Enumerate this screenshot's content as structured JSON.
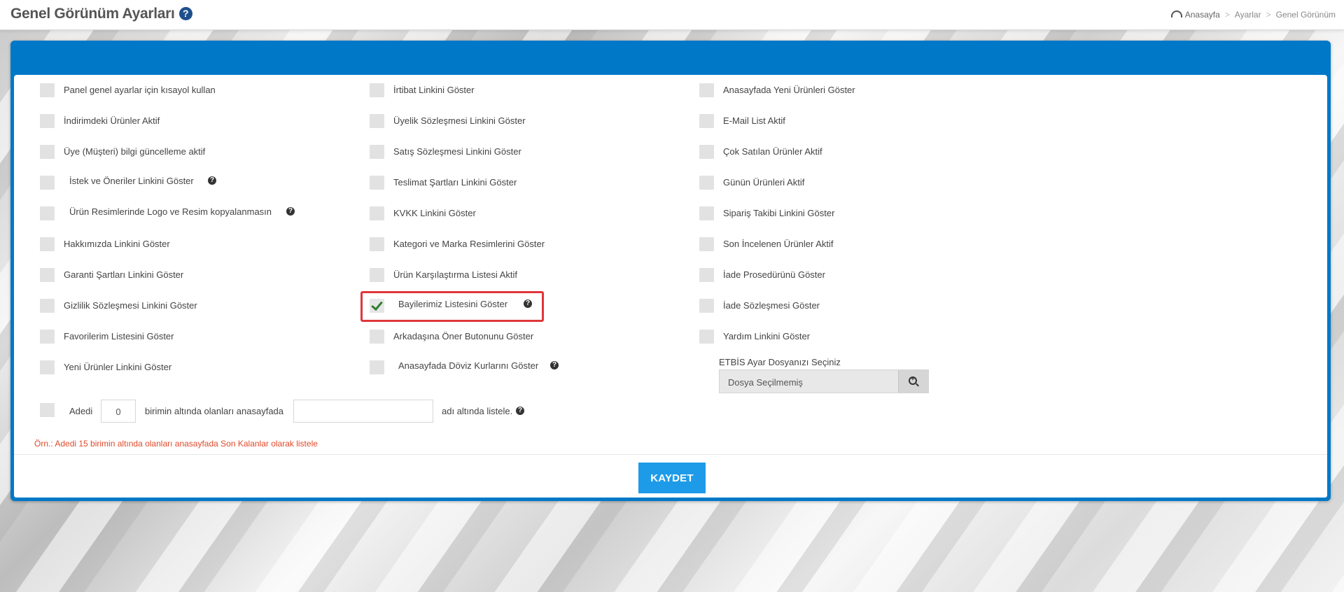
{
  "header": {
    "title": "Genel Görünüm Ayarları",
    "help_icon": "question-circle-icon",
    "breadcrumb": [
      "Anasayfa",
      "Ayarlar",
      "Genel Görünüm"
    ]
  },
  "column1": [
    {
      "label": "Panel genel ayarlar için kısayol kullan",
      "checked": false
    },
    {
      "label": "İndirimdeki Ürünler Aktif",
      "checked": false
    },
    {
      "label": "Üye (Müşteri) bilgi güncelleme aktif",
      "checked": false
    },
    {
      "label": "İstek ve Öneriler Linkini Göster",
      "checked": false,
      "help": true
    },
    {
      "label": "Ürün Resimlerinde Logo ve Resim kopyalanmasın",
      "checked": false,
      "help": true
    },
    {
      "label": "Hakkımızda Linkini Göster",
      "checked": false
    },
    {
      "label": "Garanti Şartları Linkini Göster",
      "checked": false
    },
    {
      "label": "Gizlilik Sözleşmesi Linkini Göster",
      "checked": false
    },
    {
      "label": "Favorilerim Listesini Göster",
      "checked": false
    },
    {
      "label": "Yeni Ürünler Linkini Göster",
      "checked": false
    }
  ],
  "column2": [
    {
      "label": "İrtibat Linkini Göster",
      "checked": false
    },
    {
      "label": "Üyelik Sözleşmesi Linkini Göster",
      "checked": false
    },
    {
      "label": "Satış Sözleşmesi Linkini Göster",
      "checked": false
    },
    {
      "label": "Teslimat Şartları Linkini Göster",
      "checked": false
    },
    {
      "label": "KVKK Linkini Göster",
      "checked": false
    },
    {
      "label": "Kategori ve Marka Resimlerini Göster",
      "checked": false
    },
    {
      "label": "Ürün Karşılaştırma Listesi Aktif",
      "checked": false
    },
    {
      "label": "Bayilerimiz Listesini Göster",
      "checked": true,
      "help": true
    },
    {
      "label": "Arkadaşına Öner Butonunu Göster",
      "checked": false
    },
    {
      "label": "Anasayfada Döviz Kurlarını Göster",
      "checked": false,
      "help": true
    }
  ],
  "column3": [
    {
      "label": "Anasayfada Yeni Ürünleri Göster",
      "checked": false
    },
    {
      "label": "E-Mail List Aktif",
      "checked": false
    },
    {
      "label": "Çok Satılan Ürünler Aktif",
      "checked": false
    },
    {
      "label": "Günün Ürünleri Aktif",
      "checked": false
    },
    {
      "label": "Sipariş Takibi Linkini Göster",
      "checked": false
    },
    {
      "label": "Son İncelenen Ürünler Aktif",
      "checked": false
    },
    {
      "label": "İade Prosedürünü Göster",
      "checked": false
    },
    {
      "label": "İade Sözleşmesi Göster",
      "checked": false
    },
    {
      "label": "Yardım Linkini Göster",
      "checked": false
    }
  ],
  "file": {
    "label": "ETBİS Ayar Dosyanızı Seçiniz",
    "value": "Dosya Seçilmemiş",
    "icon": "search-plus-icon"
  },
  "stock": {
    "prefix": "Adedi",
    "quantity": "0",
    "middle": "birimin altında olanları anasayfada",
    "name_value": "",
    "suffix": "adı altında listele.",
    "checked": false
  },
  "example_note": "Örn.: Adedi 15 birimin altında olanları anasayfada Son Kalanlar olarak listele",
  "save_label": "KAYDET",
  "colors": {
    "panel": "#0078c8",
    "button": "#1e9be8",
    "highlight": "#e0363a",
    "note": "#e04a2a"
  }
}
